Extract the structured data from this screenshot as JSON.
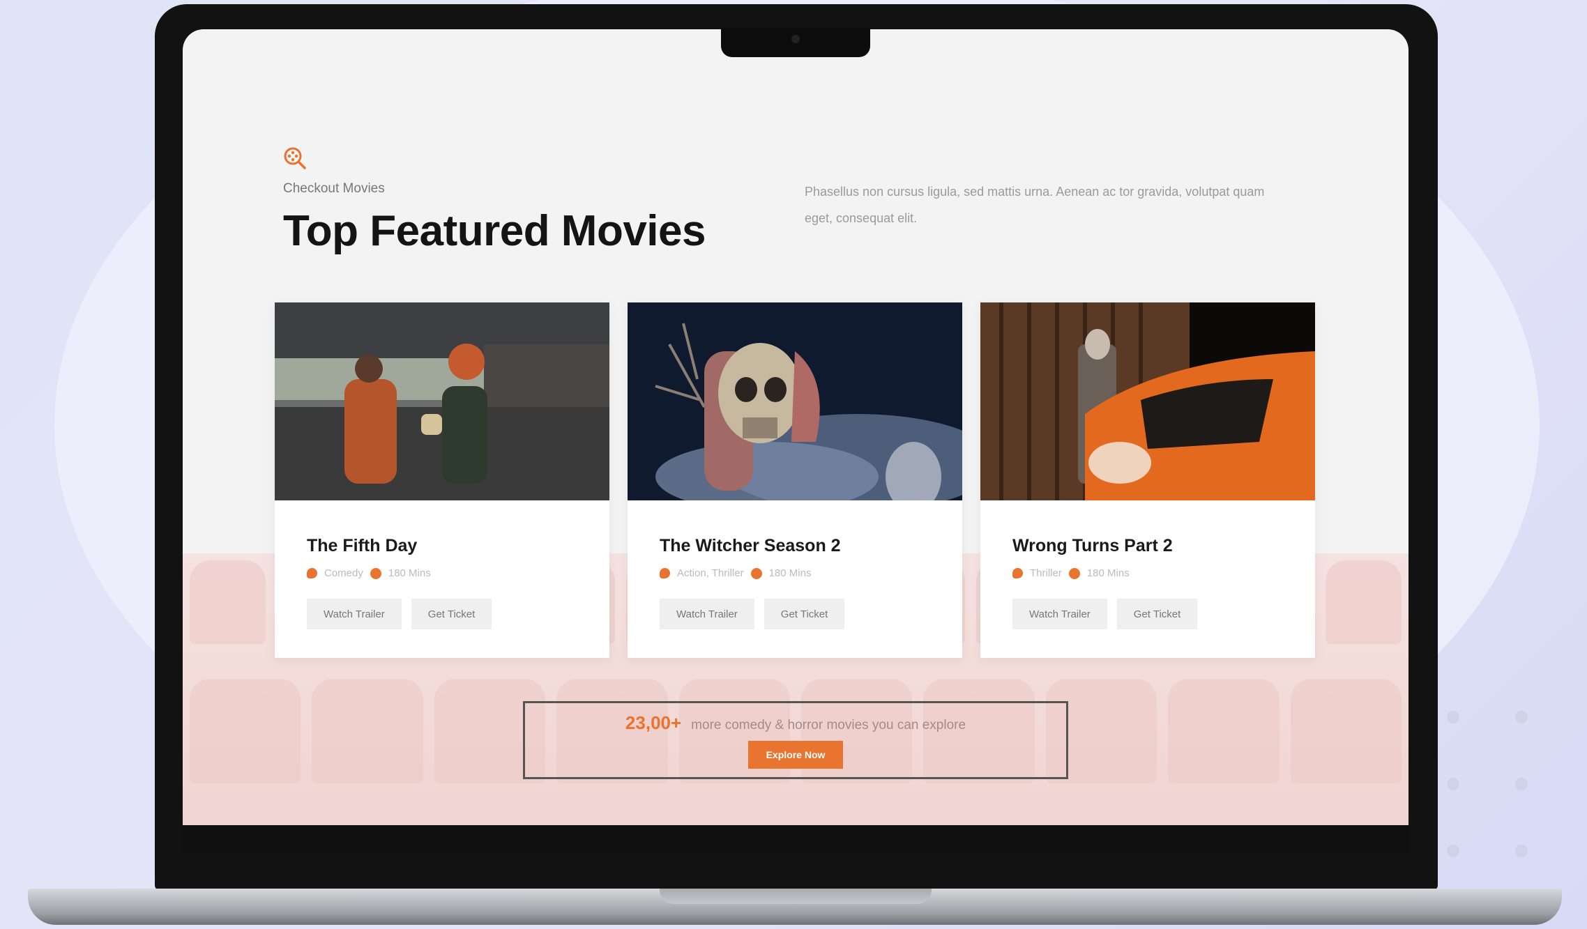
{
  "section": {
    "eyebrow": "Checkout Movies",
    "title": "Top Featured Movies",
    "description": "Phasellus non cursus ligula, sed mattis urna. Aenean ac tor gravida, volutpat quam eget, consequat elit."
  },
  "movies": [
    {
      "title": "The Fifth Day",
      "genre": "Comedy",
      "duration": "180 Mins",
      "watch_label": "Watch Trailer",
      "ticket_label": "Get Ticket"
    },
    {
      "title": "The Witcher Season 2",
      "genre": "Action, Thriller",
      "duration": "180 Mins",
      "watch_label": "Watch Trailer",
      "ticket_label": "Get Ticket"
    },
    {
      "title": "Wrong Turns Part 2",
      "genre": "Thriller",
      "duration": "180 Mins",
      "watch_label": "Watch Trailer",
      "ticket_label": "Get Ticket"
    }
  ],
  "cta": {
    "count": "23,00+",
    "text": "more comedy & horror movies you can explore",
    "button": "Explore Now"
  },
  "colors": {
    "accent": "#e8742f",
    "title": "#141414",
    "background": "#f3f3f3"
  },
  "icons": {
    "header": "film-search-icon",
    "genre": "tag-icon",
    "duration": "clock-icon"
  }
}
